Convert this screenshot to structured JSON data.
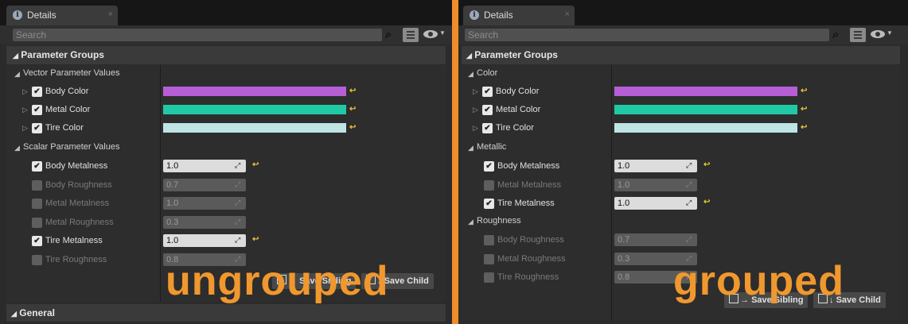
{
  "left_panel": {
    "tab_title": "Details",
    "tab_close": "×",
    "search_placeholder": "Search",
    "header": "Parameter Groups",
    "groups": [
      {
        "name": "Vector Parameter Values"
      },
      {
        "name": "Scalar Parameter Values"
      }
    ],
    "vector_params": [
      {
        "label": "Body Color",
        "color": "#b65ed6"
      },
      {
        "label": "Metal Color",
        "color": "#20c9a5"
      },
      {
        "label": "Tire Color",
        "color": "#bfe4e4"
      }
    ],
    "scalar_params": [
      {
        "label": "Body Metalness",
        "value": "1.0",
        "enabled": true
      },
      {
        "label": "Body Roughness",
        "value": "0.7",
        "enabled": false
      },
      {
        "label": "Metal Metalness",
        "value": "1.0",
        "enabled": false
      },
      {
        "label": "Metal Roughness",
        "value": "0.3",
        "enabled": false
      },
      {
        "label": "Tire Metalness",
        "value": "1.0",
        "enabled": true
      },
      {
        "label": "Tire Roughness",
        "value": "0.8",
        "enabled": false
      }
    ],
    "save_sibling": "Save Sibling",
    "save_child": "Save Child",
    "general": "General",
    "overlay_text": "ungrouped"
  },
  "right_panel": {
    "tab_title": "Details",
    "tab_close": "×",
    "search_placeholder": "Search",
    "header": "Parameter Groups",
    "groups": [
      {
        "name": "Color"
      },
      {
        "name": "Metallic"
      },
      {
        "name": "Roughness"
      }
    ],
    "color_params": [
      {
        "label": "Body Color",
        "color": "#b65ed6"
      },
      {
        "label": "Metal Color",
        "color": "#20c9a5"
      },
      {
        "label": "Tire Color",
        "color": "#bfe4e4"
      }
    ],
    "metallic_params": [
      {
        "label": "Body Metalness",
        "value": "1.0",
        "enabled": true
      },
      {
        "label": "Metal Metalness",
        "value": "1.0",
        "enabled": false
      },
      {
        "label": "Tire Metalness",
        "value": "1.0",
        "enabled": true
      }
    ],
    "roughness_params": [
      {
        "label": "Body Roughness",
        "value": "0.7",
        "enabled": false
      },
      {
        "label": "Metal Roughness",
        "value": "0.3",
        "enabled": false
      },
      {
        "label": "Tire Roughness",
        "value": "0.8",
        "enabled": false
      }
    ],
    "save_sibling": "Save Sibling",
    "save_child": "Save Child",
    "overlay_text": "grouped"
  },
  "colors": {
    "accent": "#f08c2a",
    "reset_arrow": "#e8c23a"
  },
  "icons": {
    "tab": "details-info-icon",
    "search": "magnifier-icon",
    "view": "grid-view-icon",
    "visibility": "eye-icon",
    "reset": "reset-to-default-icon",
    "drag": "numeric-drag-icon"
  },
  "glyphs": {
    "check": "✔",
    "collapse": "◢",
    "expand": "▷",
    "reset": "↩",
    "drag": "⤢",
    "arrow": "→",
    "down_arrow": "↓"
  }
}
